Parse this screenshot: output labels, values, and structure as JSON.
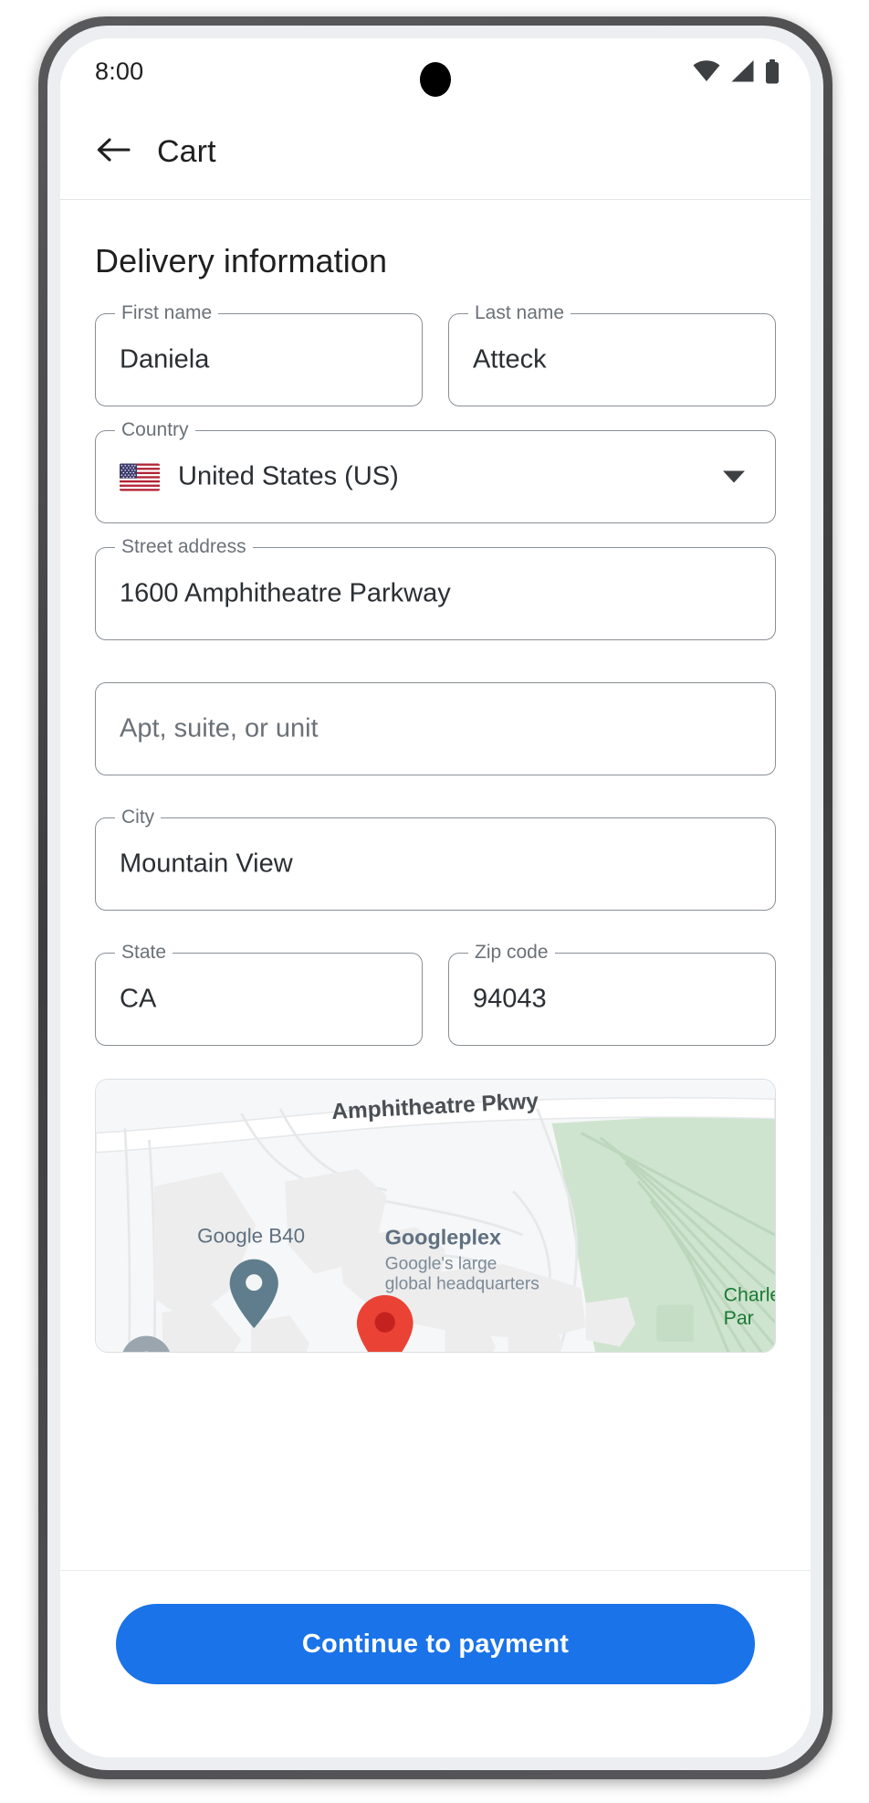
{
  "statusbar": {
    "time": "8:00",
    "icons": [
      "wifi-icon",
      "cellular-signal-icon",
      "battery-icon"
    ]
  },
  "appbar": {
    "back_icon": "arrow-back-icon",
    "title": "Cart"
  },
  "main": {
    "section_title": "Delivery information",
    "fields": [
      {
        "name": "first-name",
        "label": "First name",
        "value": "Daniela",
        "placeholder": ""
      },
      {
        "name": "last-name",
        "label": "Last name",
        "value": "Atteck",
        "placeholder": ""
      },
      {
        "name": "country",
        "label": "Country",
        "value": "United States (US)",
        "placeholder": "",
        "flag": "us-flag-icon",
        "caret": "chevron-down-icon"
      },
      {
        "name": "street-address",
        "label": "Street address",
        "value": "1600 Amphitheatre Parkway",
        "placeholder": ""
      },
      {
        "name": "apt-suite-unit",
        "label": "",
        "value": "",
        "placeholder": "Apt, suite, or unit"
      },
      {
        "name": "city",
        "label": "City",
        "value": "Mountain View",
        "placeholder": ""
      },
      {
        "name": "state",
        "label": "State",
        "value": "CA",
        "placeholder": ""
      },
      {
        "name": "zip-code",
        "label": "Zip code",
        "value": "94043",
        "placeholder": ""
      }
    ],
    "map": {
      "labels": {
        "street": "Amphitheatre Pkwy",
        "building": "Google B40",
        "poi_title": "Googleplex",
        "poi_subtitle_line1": "Google's large",
        "poi_subtitle_line2": "global headquarters",
        "park_line1": "Charle",
        "park_line2": "Par"
      },
      "markers": [
        "location-pin-red",
        "place-pin-grey"
      ]
    }
  },
  "bottombar": {
    "cta_label": "Continue to payment"
  },
  "colors": {
    "accent": "#1a73e8",
    "text_primary": "#1f1f1f",
    "text_secondary": "#6b7178",
    "field_outline": "#8a8f96",
    "map_park": "#cfe4cf",
    "map_pin": "#ea4335"
  }
}
